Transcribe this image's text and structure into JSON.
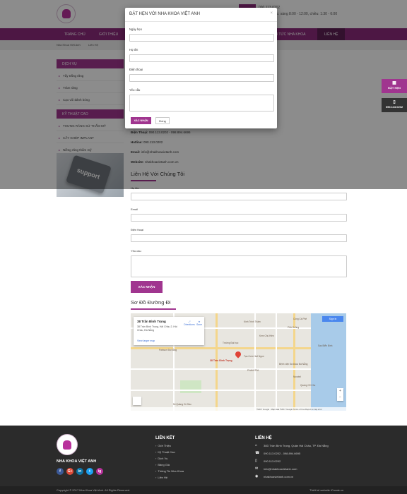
{
  "header": {
    "hotline": "090.113.0202",
    "hours": "Giờ làm việc: sáng 8:00 - 12:00, chiều: 1:30 - 6:00",
    "nav": [
      "TRANG CHỦ",
      "GIỚI THIỆU",
      "TIN TỨC NHA KHOA",
      "LIÊN HỆ"
    ],
    "active_nav": "LIÊN HỆ"
  },
  "breadcrumb": [
    "Nha Khoa Việt Anh",
    "Liên Hệ"
  ],
  "sidebar": {
    "services_title": "DỊCH VỤ",
    "services": [
      "Tẩy trắng răng",
      "Trám răng",
      "Cạo vôi đánh bóng"
    ],
    "tech_title": "KỸ THUẬT CAO",
    "tech": [
      "THƯNG RĂNG SỨ THẨM MỸ",
      "CẤY GHÉP IMPLANT",
      "Niềng răng thẩm mỹ"
    ],
    "support_text": "support"
  },
  "contact": {
    "phone_label": "Điện Thoại:",
    "phone": "090.113.0202 - 098.894.6695",
    "hotline_label": "Hotline:",
    "hotline": "090.113.0202",
    "email_label": "Email:",
    "email": "info@nhakhoavietanh.com",
    "website_label": "Website:",
    "website": "nhakhoavietanh.com.vn"
  },
  "contact_form": {
    "title": "Liên Hệ Với Chúng Tôi",
    "name_label": "Họ tên",
    "email_label": "Email",
    "phone_label": "Điện thoại",
    "request_label": "Yêu cầu",
    "submit": "XÁC NHẬN"
  },
  "map_section": {
    "title": "Sơ Đồ Đường Đi",
    "card_title": "38 Trần Bình Trọng",
    "card_address": "38 Trần Bình Trọng, Hải Châu 2, Hải Châu, Đà Nẵng",
    "directions": "Directions",
    "save": "Save",
    "larger_map": "View larger map",
    "pin_label": "38 Trần Bình Trọng",
    "sign_in": "Sign in",
    "places": [
      "Cồng Cà Phê",
      "Kính Trình Thâm",
      "Phở Dzũng",
      "Parkson Đà Nẵng",
      "Trường Đại học",
      "Kem Chú Hiền",
      "Tạo Cơm Huế Ngon",
      "Bệnh viện Đa khoa Đà Nẵng",
      "PHAM SPA",
      "Quang Cổ Chu",
      "Novotel",
      "Mì Quảng Cô Sáu",
      "Sao Biển Bình"
    ],
    "footer_text": "©2017 Google · Map data ©2017 Google   Terms of Use   Report a map error"
  },
  "floating": {
    "book_label": "ĐẶT HẸN",
    "call_label": "090.113.0202"
  },
  "modal": {
    "title": "ĐẶT HẸN VỚI NHA KHOA VIỆT ANH",
    "close": "×",
    "date_label": "Ngày hẹn",
    "name_label": "Họ tên",
    "phone_label": "Điện thoại",
    "request_label": "Yêu cầu",
    "submit": "XÁC NHẬN",
    "cancel": "Đóng"
  },
  "footer": {
    "brand": "NHA KHOA VIỆT ANH",
    "links_title": "LIÊN KẾT",
    "links": [
      "Giới Thiệu",
      "Kỹ Thuật Cao",
      "Dịch Vụ",
      "Bảng Giá",
      "Thông Tin Nha Khoa",
      "Liên Hệ"
    ],
    "contact_title": "LIÊN HỆ",
    "address": "38D Trần Bình Trọng, Quận Hải Châu, TP. Đà Nẵng",
    "phone": "090.113.0202 - 098.894.6695",
    "hotline": "090.113.0202",
    "email": "info@nhakhoavietanh.com",
    "website": "nhakhoavietanh.com.vn",
    "social": [
      "f",
      "G+",
      "in",
      "t",
      "ig"
    ],
    "copyright": "Copyright © 2017 Nha Khoa Việt Anh. All Rights Reserved.",
    "designer": "Thiết kế website iCreate.vn"
  },
  "colors": {
    "brand": "#a0358f",
    "nav": "#8c2a7c",
    "footer": "#2b2b2b"
  }
}
